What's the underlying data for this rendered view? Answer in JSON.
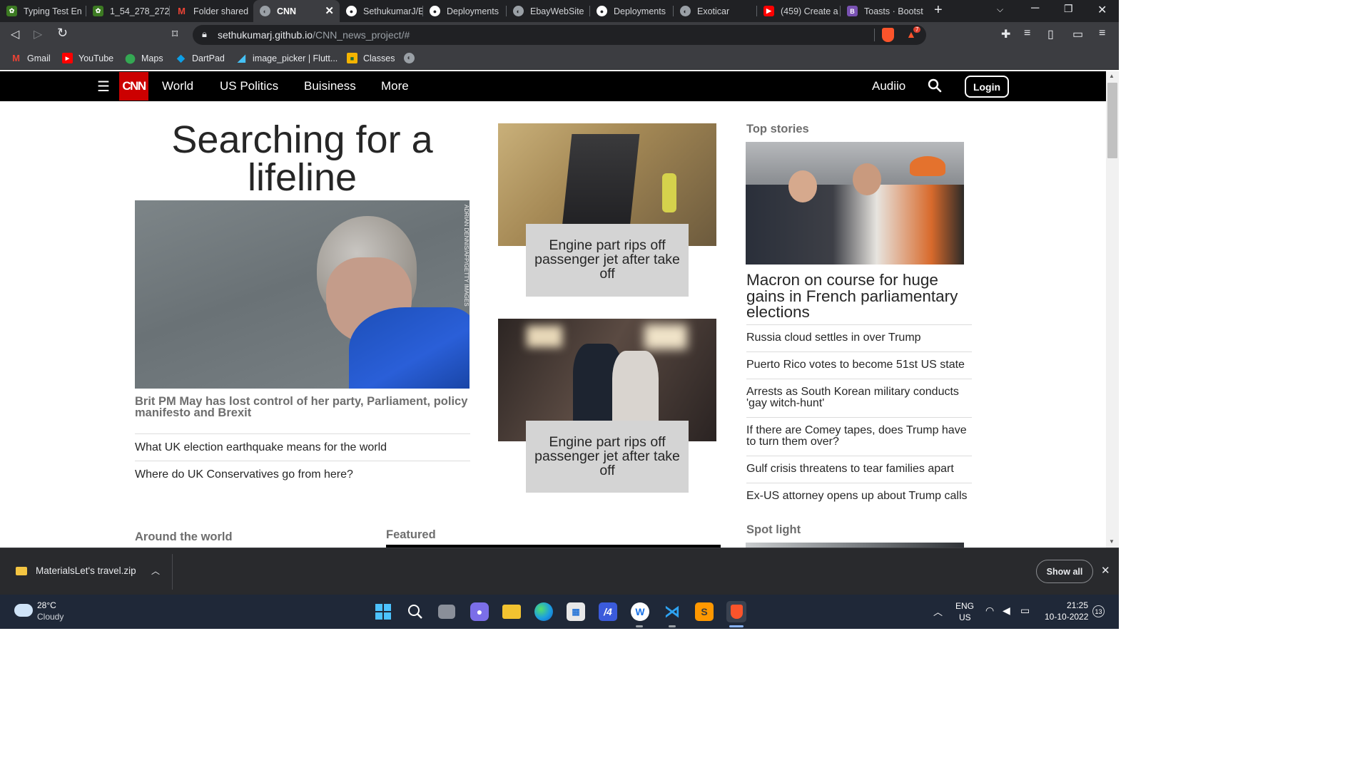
{
  "browser": {
    "tabs": [
      {
        "title": "Typing Test En",
        "icon": "tab-favicon-icon",
        "color": "#3c7a22"
      },
      {
        "title": "1_54_278_272_",
        "icon": "tab-favicon-icon",
        "color": "#3c7a22"
      },
      {
        "title": "Folder shared",
        "icon": "gmail-icon",
        "color": "#ea4335"
      },
      {
        "title": "CNN",
        "icon": "globe-icon",
        "color": "#9aa0a6",
        "active": true
      },
      {
        "title": "SethukumarJ/E",
        "icon": "github-icon",
        "color": "#ffffff"
      },
      {
        "title": "Deployments",
        "icon": "github-icon",
        "color": "#ffffff"
      },
      {
        "title": "EbayWebSite",
        "icon": "globe-icon",
        "color": "#9aa0a6"
      },
      {
        "title": "Deployments",
        "icon": "github-icon",
        "color": "#ffffff"
      },
      {
        "title": "Exoticar",
        "icon": "globe-icon",
        "color": "#9aa0a6"
      },
      {
        "title": "(459) Create a",
        "icon": "youtube-icon",
        "color": "#ff0000"
      },
      {
        "title": "Toasts · Bootst",
        "icon": "bootstrap-icon",
        "color": "#7952b3"
      }
    ],
    "url_host": "sethukumarj.github.io",
    "url_path": "/CNN_news_project/#",
    "shield_badge": "7",
    "bookmarks": [
      {
        "label": "Gmail",
        "icon": "gmail-icon"
      },
      {
        "label": "YouTube",
        "icon": "youtube-icon"
      },
      {
        "label": "Maps",
        "icon": "maps-icon"
      },
      {
        "label": "DartPad",
        "icon": "dartpad-icon"
      },
      {
        "label": "image_picker | Flutt...",
        "icon": "flutter-icon"
      },
      {
        "label": "Classes",
        "icon": "classroom-icon"
      }
    ]
  },
  "site": {
    "logo": "CNN",
    "nav": [
      "World",
      "US Politics",
      "Buisiness",
      "More"
    ],
    "audio": "Audiio",
    "login": "Login"
  },
  "main": {
    "headline": "Searching for a lifeline",
    "photo_credit": "ADRIAN DENNIS/AFP/GETTY IMAGES",
    "caption": "Brit PM May has lost control of her party, Parliament, policy manifesto and Brexit",
    "related": [
      "What UK election earthquake means for the world",
      "Where do UK Conservatives go from here?"
    ],
    "cards": [
      {
        "caption": "Engine part rips off passenger jet after take off"
      },
      {
        "caption": "Engine part rips off passenger jet after take off"
      }
    ],
    "around_the_world": "Around the world",
    "featured": "Featured"
  },
  "sidebar": {
    "top_stories_title": "Top stories",
    "top_headline": "Macron on course for huge gains in French parliamentary elections",
    "stories": [
      "Russia cloud settles in over Trump",
      "Puerto Rico votes to become 51st US state",
      "Arrests as South Korean military conducts 'gay witch-hunt'",
      "If there are Comey tapes, does Trump have to turn them over?",
      "Gulf crisis threatens to tear families apart",
      "Ex-US attorney opens up about Trump calls"
    ],
    "spotlight_title": "Spot light"
  },
  "download": {
    "filename": "MaterialsLet's travel.zip",
    "show_all": "Show all"
  },
  "taskbar": {
    "temperature": "28°C",
    "weather": "Cloudy",
    "lang": "ENG",
    "region": "US",
    "time": "21:25",
    "date": "10-10-2022",
    "notification_count": "13"
  }
}
